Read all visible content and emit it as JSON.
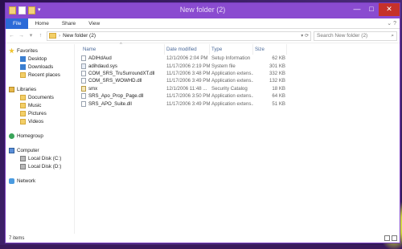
{
  "window": {
    "title": "New folder (2)",
    "controls": {
      "minimize": "—",
      "maximize": "□",
      "close": "✕"
    }
  },
  "ribbon": {
    "tabs": [
      "File",
      "Home",
      "Share",
      "View"
    ]
  },
  "address": {
    "path": "New folder (2)",
    "search_placeholder": "Search New folder (2)"
  },
  "nav": {
    "favorites": {
      "label": "Favorites",
      "items": [
        "Desktop",
        "Downloads",
        "Recent places"
      ]
    },
    "libraries": {
      "label": "Libraries",
      "items": [
        "Documents",
        "Music",
        "Pictures",
        "Videos"
      ]
    },
    "homegroup": "Homegroup",
    "computer": {
      "label": "Computer",
      "items": [
        "Local Disk (C:)",
        "Local Disk (D:)"
      ]
    },
    "network": "Network"
  },
  "columns": {
    "name": "Name",
    "date": "Date modified",
    "type": "Type",
    "size": "Size"
  },
  "files": [
    {
      "name": "ADIHdAud",
      "date": "12/1/2006 2:04 PM",
      "type": "Setup Information",
      "size": "62 KB",
      "icon": "setup-file-icon"
    },
    {
      "name": "adihdaud.sys",
      "date": "11/17/2006 2:19 PM",
      "type": "System file",
      "size": "301 KB",
      "icon": "system-file-icon"
    },
    {
      "name": "COM_SRS_TruSurroundXT.dll",
      "date": "11/17/2006 3:48 PM",
      "type": "Application extens...",
      "size": "332 KB",
      "icon": "dll-file-icon"
    },
    {
      "name": "COM_SRS_WOWHD.dll",
      "date": "11/17/2006 3:49 PM",
      "type": "Application extens...",
      "size": "132 KB",
      "icon": "dll-file-icon"
    },
    {
      "name": "smx",
      "date": "12/1/2006 11:48 ...",
      "type": "Security Catalog",
      "size": "18 KB",
      "icon": "catalog-file-icon"
    },
    {
      "name": "SRS_Apo_Prop_Page.dll",
      "date": "11/17/2006 3:50 PM",
      "type": "Application extens...",
      "size": "64 KB",
      "icon": "dll-file-icon"
    },
    {
      "name": "SRS_APO_Suite.dll",
      "date": "11/17/2006 3:49 PM",
      "type": "Application extens...",
      "size": "51 KB",
      "icon": "dll-file-icon"
    }
  ],
  "status": {
    "count": "7 items"
  }
}
